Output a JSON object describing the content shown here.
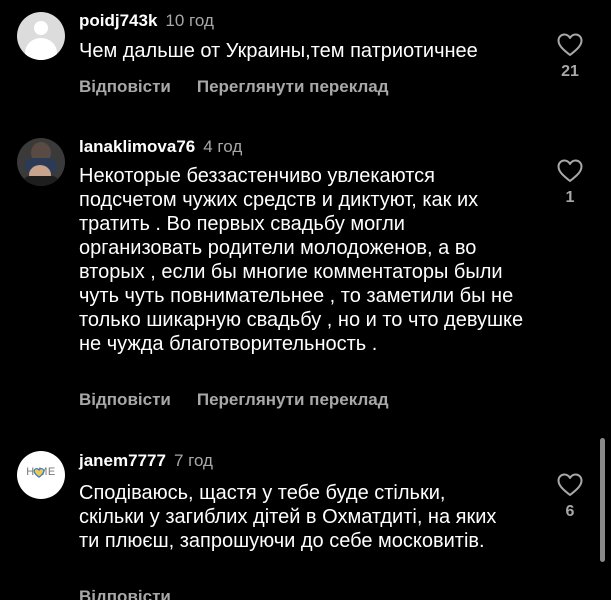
{
  "colors": {
    "background": "#000000",
    "text_primary": "#ffffff",
    "text_secondary": "#a8a8a8"
  },
  "comments": [
    {
      "username": "poidj743k",
      "time": "10 год",
      "text": "Чем дальше от Украины,тем патриотичнее",
      "reply_label": "Відповісти",
      "translate_label": "Переглянути переклад",
      "likes": "21",
      "avatar": "default-avatar-icon"
    },
    {
      "username": "lanaklimova76",
      "time": "4 год",
      "text": "Некоторые беззастенчиво увлекаются подсчетом чужих средств и диктуют, как их тратить . Во первых свадьбу могли организовать родители молодоженов, а во вторых , если бы многие комментаторы были чуть чуть повнимательнее , то заметили бы не только шикарную свадьбу , но  и то что девушке не чужда благотворительность .",
      "reply_label": "Відповісти",
      "translate_label": "Переглянути переклад",
      "likes": "1",
      "avatar": "photo-avatar"
    },
    {
      "username": "janem7777",
      "time": "7 год",
      "text": "Сподіваюсь, щастя у тебе буде стільки, скільки у загиблих дітей в Охматдиті, на яких ти плюєш, запрошуючи до себе московитів.",
      "reply_label": "Відповісти",
      "translate_label": "",
      "likes": "6",
      "avatar": "home-avatar",
      "avatar_text": "H  ME"
    }
  ]
}
